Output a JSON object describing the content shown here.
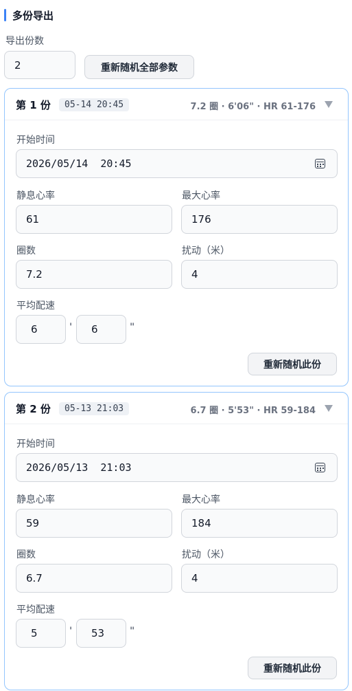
{
  "section": {
    "title": "多份导出"
  },
  "export_count": {
    "label": "导出份数",
    "value": "2",
    "reroll_all_label": "重新随机全部参数"
  },
  "labels": {
    "start_time": "开始时间",
    "rest_hr": "静息心率",
    "max_hr": "最大心率",
    "laps": "圈数",
    "jitter": "扰动（米）",
    "pace": "平均配速",
    "minute_mark": "'",
    "second_mark": "\"",
    "reroll_one": "重新随机此份"
  },
  "cards": [
    {
      "title": "第 1 份",
      "time_badge": "05-14 20:45",
      "summary": "7.2 圈 · 6'06\" · HR 61-176",
      "start_time": "2026/05/14  20:45",
      "rest_hr": "61",
      "max_hr": "176",
      "laps": "7.2",
      "jitter": "4",
      "pace_min": "6",
      "pace_sec": "6"
    },
    {
      "title": "第 2 份",
      "time_badge": "05-13 21:03",
      "summary": "6.7 圈 · 5'53\" · HR 59-184",
      "start_time": "2026/05/13  21:03",
      "rest_hr": "59",
      "max_hr": "184",
      "laps": "6.7",
      "jitter": "4",
      "pace_min": "5",
      "pace_sec": "53"
    }
  ]
}
